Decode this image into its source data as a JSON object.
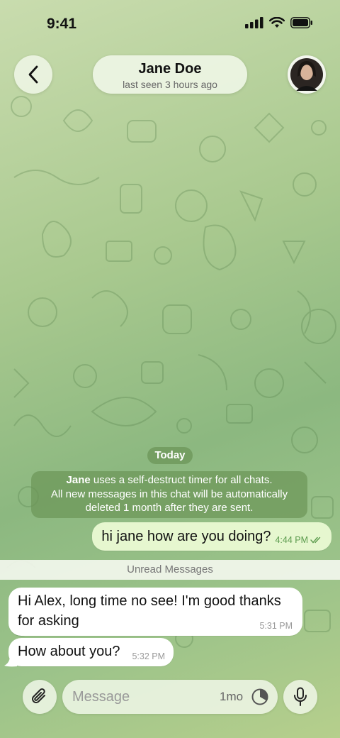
{
  "status_bar": {
    "time": "9:41"
  },
  "header": {
    "contact_name": "Jane Doe",
    "last_seen": "last seen 3 hours ago"
  },
  "chat": {
    "date_label": "Today",
    "service_message": {
      "name": "Jane",
      "line1_rest": "uses a self-destruct timer for all chats.",
      "line2": "All new messages in this chat will be automatically",
      "line3": "deleted 1 month after they are sent."
    },
    "messages": [
      {
        "direction": "out",
        "text": "hi jane how are you doing?",
        "time": "4:44 PM",
        "status": "read"
      },
      {
        "direction": "in",
        "text": "Hi Alex, long time no see! I'm good thanks for asking",
        "time": "5:31 PM"
      },
      {
        "direction": "in",
        "text": "How about you?",
        "time": "5:32 PM"
      }
    ],
    "unread_label": "Unread Messages"
  },
  "composer": {
    "placeholder": "Message",
    "timer_label": "1mo"
  },
  "colors": {
    "outgoing_bubble": "#e6f7cf",
    "incoming_bubble": "#ffffff",
    "service_bg": "#6c9658",
    "accent": "#5a9a4c"
  },
  "icons": [
    "back-chevron-icon",
    "avatar",
    "signal-icon",
    "wifi-icon",
    "battery-icon",
    "double-check-icon",
    "paperclip-icon",
    "timer-icon",
    "microphone-icon"
  ]
}
